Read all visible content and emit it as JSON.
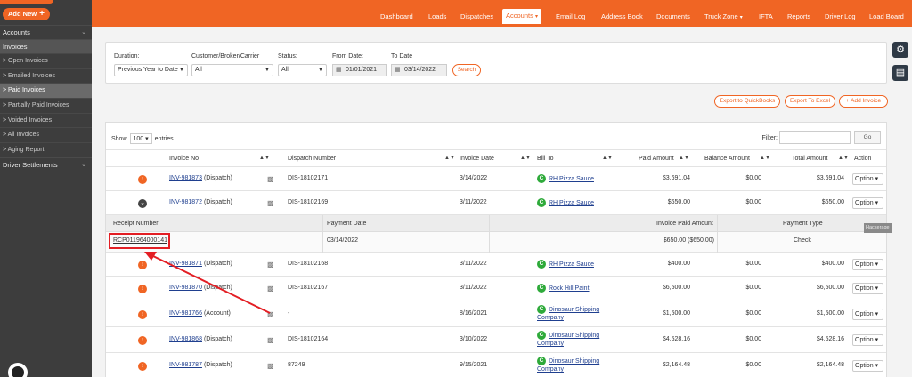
{
  "sidebar": {
    "add_new_label": "Add New",
    "sections": [
      {
        "label": "Accounts"
      },
      {
        "label": "Invoices"
      },
      {
        "label": "Driver Settlements"
      }
    ],
    "invoice_items": [
      {
        "label": "> Open Invoices"
      },
      {
        "label": "> Emailed Invoices"
      },
      {
        "label": "> Paid Invoices"
      },
      {
        "label": "> Partially Paid Invoices"
      },
      {
        "label": "> Voided Invoices"
      },
      {
        "label": "> All Invoices"
      },
      {
        "label": "> Aging Report"
      }
    ]
  },
  "topnav": {
    "items": [
      {
        "label": "Dashboard"
      },
      {
        "label": "Loads"
      },
      {
        "label": "Dispatches"
      },
      {
        "label": "Accounts"
      },
      {
        "label": "Email Log"
      },
      {
        "label": "Address Book"
      },
      {
        "label": "Documents"
      },
      {
        "label": "Truck Zone"
      },
      {
        "label": "IFTA"
      },
      {
        "label": "Reports"
      },
      {
        "label": "Driver Log"
      },
      {
        "label": "Load Board"
      }
    ]
  },
  "filters": {
    "duration_label": "Duration:",
    "duration_value": "Previous Year to Date",
    "customer_label": "Customer/Broker/Carrier",
    "customer_value": "All",
    "status_label": "Status:",
    "status_value": "All",
    "from_label": "From Date:",
    "from_value": "01/01/2021",
    "to_label": "To Date",
    "to_value": "03/14/2022",
    "search_label": "Search"
  },
  "actions": {
    "export_qb": "Export to QuickBooks",
    "export_excel": "Export To Excel",
    "add_invoice": "+ Add Invoice"
  },
  "table": {
    "show_label": "Show",
    "show_value": "100",
    "entries_label": "entries",
    "filter_label": "Filter:",
    "go_label": "Go",
    "headers": {
      "invoice_no": "Invoice No",
      "dispatch_number": "Dispatch Number",
      "invoice_date": "Invoice Date",
      "bill_to": "Bill To",
      "paid_amount": "Paid Amount",
      "balance_amount": "Balance Amount",
      "total_amount": "Total Amount",
      "action": "Action"
    },
    "option_label": "Option",
    "rows": [
      {
        "inv": "INV-981873",
        "type": "(Dispatch)",
        "dispatch": "DIS-18102171",
        "date": "3/14/2022",
        "bill1": "RH Pizza Sauce",
        "bill2": "",
        "paid": "$3,691.04",
        "balance": "$0.00",
        "total": "$3,691.04"
      },
      {
        "inv": "INV-981872",
        "type": "(Dispatch)",
        "dispatch": "DIS-18102169",
        "date": "3/11/2022",
        "bill1": "RH Pizza Sauce",
        "bill2": "",
        "paid": "$650.00",
        "balance": "$0.00",
        "total": "$650.00"
      },
      {
        "inv": "INV-981871",
        "type": "(Dispatch)",
        "dispatch": "DIS-18102168",
        "date": "3/11/2022",
        "bill1": "RH Pizza Sauce",
        "bill2": "",
        "paid": "$400.00",
        "balance": "$0.00",
        "total": "$400.00"
      },
      {
        "inv": "INV-981870",
        "type": "(Dispatch)",
        "dispatch": "DIS-18102167",
        "date": "3/11/2022",
        "bill1": "Rock Hill Paint",
        "bill2": "",
        "paid": "$6,500.00",
        "balance": "$0.00",
        "total": "$6,500.00"
      },
      {
        "inv": "INV-981766",
        "type": "(Account)",
        "dispatch": "-",
        "date": "8/16/2021",
        "bill1": "Dinosaur Shipping",
        "bill2": "Company",
        "paid": "$1,500.00",
        "balance": "$0.00",
        "total": "$1,500.00"
      },
      {
        "inv": "INV-981868",
        "type": "(Dispatch)",
        "dispatch": "DIS-18102164",
        "date": "3/10/2022",
        "bill1": "Dinosaur Shipping",
        "bill2": "Company",
        "paid": "$4,528.16",
        "balance": "$0.00",
        "total": "$4,528.16"
      },
      {
        "inv": "INV-981787",
        "type": "(Dispatch)",
        "dispatch": "87249",
        "date": "9/15/2021",
        "bill1": "Dinosaur Shipping",
        "bill2": "Company",
        "paid": "$2,164.48",
        "balance": "$0.00",
        "total": "$2,164.48"
      }
    ],
    "receipt": {
      "headers": {
        "receipt_number": "Receipt Number",
        "payment_date": "Payment Date",
        "invoice_paid_amount": "Invoice Paid Amount",
        "payment_type": "Payment Type"
      },
      "number": "RCP011964000141",
      "date": "03/14/2022",
      "amount": "$650.00 ($650.00)",
      "type": "Check"
    },
    "tooltip": "Hackerage"
  },
  "colors": {
    "brand_orange": "#f06524",
    "sidebar_bg": "#3d3d3d",
    "annotation_red": "#e31e24",
    "customer_badge_green": "#2eaa3a"
  },
  "icons": [
    "plus-icon",
    "chevron-down-icon",
    "calendar-icon",
    "expand-icon",
    "truck-icon",
    "customer-badge-icon",
    "settings-icon",
    "document-icon",
    "annotation-arrow"
  ]
}
